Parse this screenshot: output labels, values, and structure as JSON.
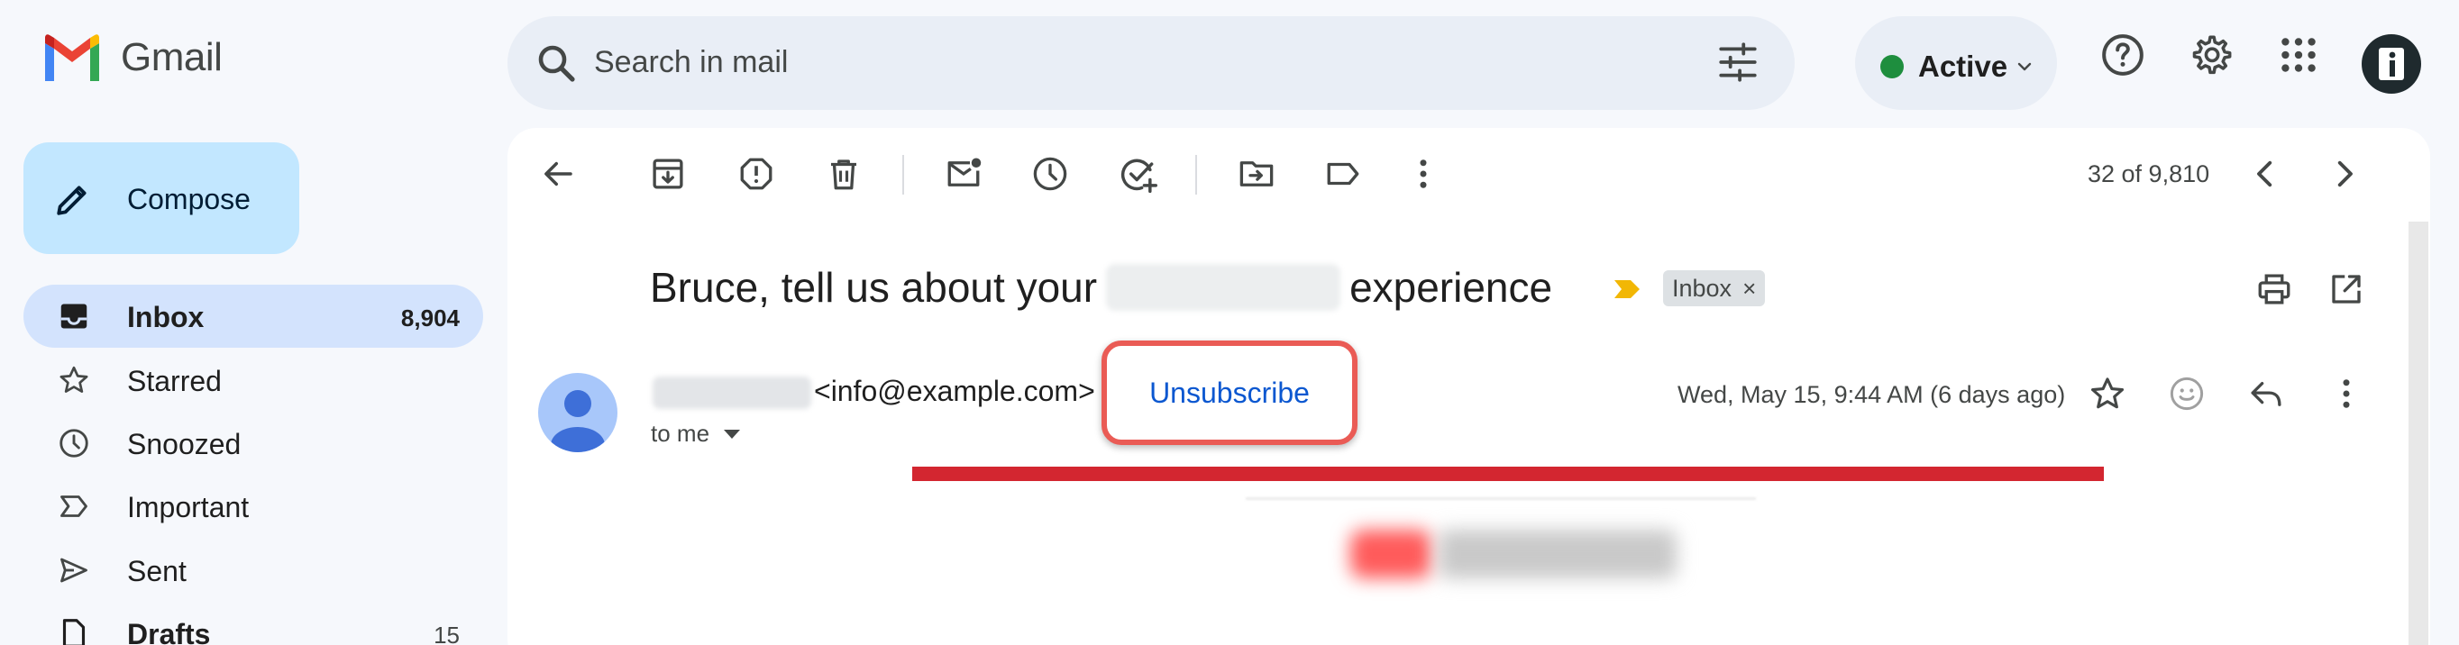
{
  "app": {
    "name": "Gmail"
  },
  "search": {
    "placeholder": "Search in mail"
  },
  "status": {
    "label": "Active"
  },
  "compose": {
    "label": "Compose"
  },
  "sidebar": {
    "items": [
      {
        "label": "Inbox",
        "count": "8,904"
      },
      {
        "label": "Starred",
        "count": ""
      },
      {
        "label": "Snoozed",
        "count": ""
      },
      {
        "label": "Important",
        "count": ""
      },
      {
        "label": "Sent",
        "count": ""
      },
      {
        "label": "Drafts",
        "count": "15"
      }
    ]
  },
  "toolbar": {
    "pagination": "32 of 9,810"
  },
  "email": {
    "subject_before": "Bruce, tell us about your",
    "subject_after": "experience",
    "label_chip": "Inbox",
    "chip_close": "×",
    "sender_email": "<info@example.com>",
    "unsubscribe_label": "Unsubscribe",
    "recipient": "to me",
    "date": "Wed, May 15, 9:44 AM (6 days ago)"
  },
  "colors": {
    "accent_blue": "#0b57d0",
    "highlight_red": "#ea5b55",
    "status_green": "#1e8e3e",
    "annotation_bar": "#d32630"
  },
  "icons": [
    "gmail-logo-icon",
    "search-icon",
    "tune-icon",
    "chevron-down-icon",
    "help-icon",
    "settings-icon",
    "apps-grid-icon",
    "pencil-icon",
    "inbox-icon",
    "star-icon",
    "clock-icon",
    "important-icon",
    "send-icon",
    "draft-icon",
    "back-arrow-icon",
    "archive-icon",
    "report-spam-icon",
    "delete-icon",
    "mark-unread-icon",
    "snooze-icon",
    "add-task-icon",
    "move-to-icon",
    "label-icon",
    "more-vert-icon",
    "chevron-left-icon",
    "chevron-right-icon",
    "print-icon",
    "open-new-window-icon",
    "importance-marker-icon",
    "person-icon",
    "emoji-icon",
    "reply-icon"
  ]
}
